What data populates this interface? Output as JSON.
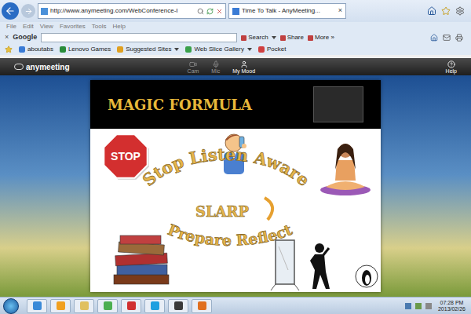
{
  "browser": {
    "address": "http://www.anymeeting.com/WebConference-I",
    "tabs": [
      {
        "label": "Time To Talk - AnyMeeting...",
        "close": "×",
        "selected": true
      }
    ],
    "menu": [
      "File",
      "Edit",
      "View",
      "Favorites",
      "Tools",
      "Help"
    ],
    "google_toolbar": {
      "close": "×",
      "brand": "Google",
      "buttons": [
        {
          "label": "Search",
          "dropdown": true
        },
        {
          "label": "Share",
          "dropdown": false
        },
        {
          "label": "More »",
          "dropdown": false
        }
      ]
    },
    "favorites": [
      {
        "label": "aboutabs",
        "dropdown": false,
        "color": "#3a7bd5"
      },
      {
        "label": "Lenovo Games",
        "dropdown": false,
        "color": "#2a8c3a"
      },
      {
        "label": "Suggested Sites",
        "dropdown": true,
        "color": "#e0a020"
      },
      {
        "label": "Web Slice Gallery",
        "dropdown": true,
        "color": "#3aa04a"
      },
      {
        "label": "Pocket",
        "dropdown": false,
        "color": "#d04040"
      }
    ]
  },
  "app": {
    "logo": "anymeeting",
    "controls": [
      {
        "label": "Cam",
        "active": false
      },
      {
        "label": "Mic",
        "active": false
      },
      {
        "label": "My Mood",
        "active": true
      }
    ],
    "help": "Help"
  },
  "slide": {
    "title": "MAGIC FORMULA",
    "stop_sign": "STOP",
    "arc_top": "Stop Listen Aware",
    "center": "SLARP",
    "arc_bottom": "Prepare Reflect"
  },
  "taskbar": {
    "time": "07:28 PM",
    "date": "2013/02/26"
  }
}
